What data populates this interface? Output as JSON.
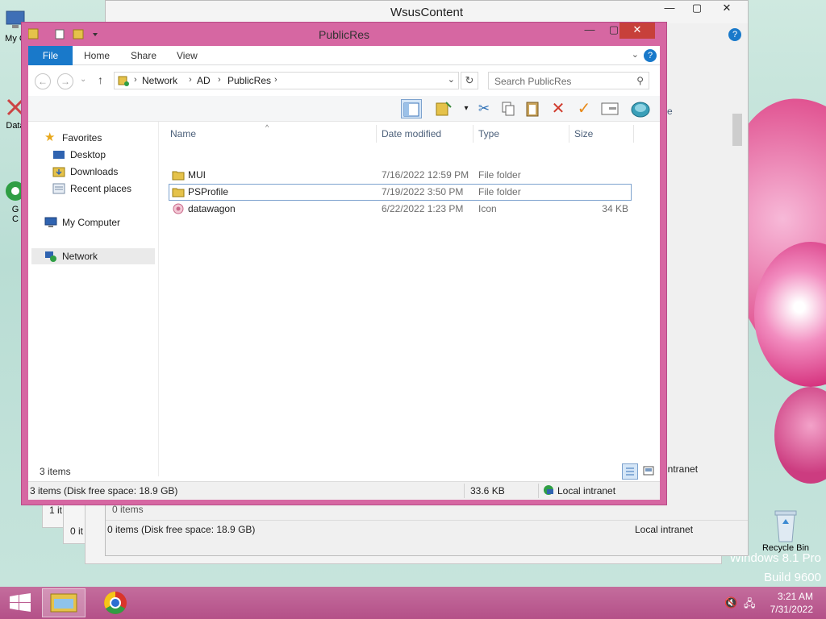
{
  "desktop": {
    "icons": [
      {
        "label": "My C"
      },
      {
        "label": "Data"
      },
      {
        "label": "G"
      },
      {
        "label": "C"
      }
    ],
    "recycle_bin": "Recycle Bin",
    "watermark_line1": "Windows 8.1 Pro",
    "watermark_line2": "Build 9600"
  },
  "back_window": {
    "title": "WsusContent",
    "status_items": "0 items",
    "status_disk": "0 items (Disk free space: 18.9 GB)",
    "status_zone": "Local intranet",
    "partial_items_1": "1 it",
    "partial_items_2": "0 it",
    "partial_zone": "intranet",
    "partial_size_header": "ze"
  },
  "window": {
    "title": "PublicRes",
    "tabs": [
      "File",
      "Home",
      "Share",
      "View"
    ],
    "breadcrumb": [
      "Network",
      "AD",
      "PublicRes"
    ],
    "search_placeholder": "Search PublicRes",
    "nav": {
      "favorites": "Favorites",
      "desktop": "Desktop",
      "downloads": "Downloads",
      "recent": "Recent places",
      "my_computer": "My Computer",
      "network": "Network"
    },
    "columns": {
      "name": "Name",
      "date": "Date modified",
      "type": "Type",
      "size": "Size"
    },
    "files": [
      {
        "name": "MUI",
        "date": "7/16/2022 12:59 PM",
        "type": "File folder",
        "size": ""
      },
      {
        "name": "PSProfile",
        "date": "7/19/2022 3:50 PM",
        "type": "File folder",
        "size": ""
      },
      {
        "name": "datawagon",
        "date": "6/22/2022 1:23 PM",
        "type": "Icon",
        "size": "34 KB"
      }
    ],
    "items_count": "3 items",
    "status_disk": "3 items (Disk free space: 18.9 GB)",
    "status_size": "33.6 KB",
    "status_zone": "Local intranet"
  },
  "taskbar": {
    "time": "3:21 AM",
    "date": "7/31/2022"
  },
  "colors": {
    "accent": "#d667a2",
    "file_tab": "#1979ca",
    "close": "#c7403a",
    "taskbar": "#b45088"
  }
}
